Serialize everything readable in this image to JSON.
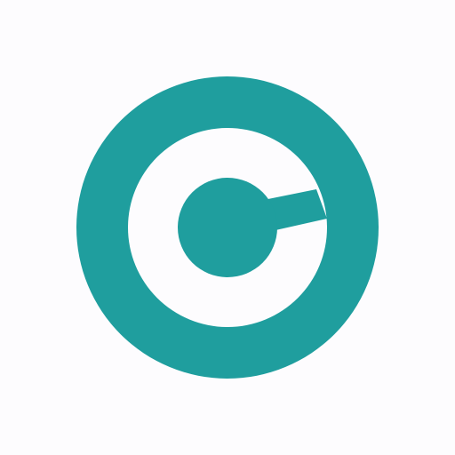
{
  "logo": {
    "icon": "target-logo-icon",
    "colors": {
      "primary": "#1f9e9e",
      "background": "#fdfcfe"
    }
  }
}
